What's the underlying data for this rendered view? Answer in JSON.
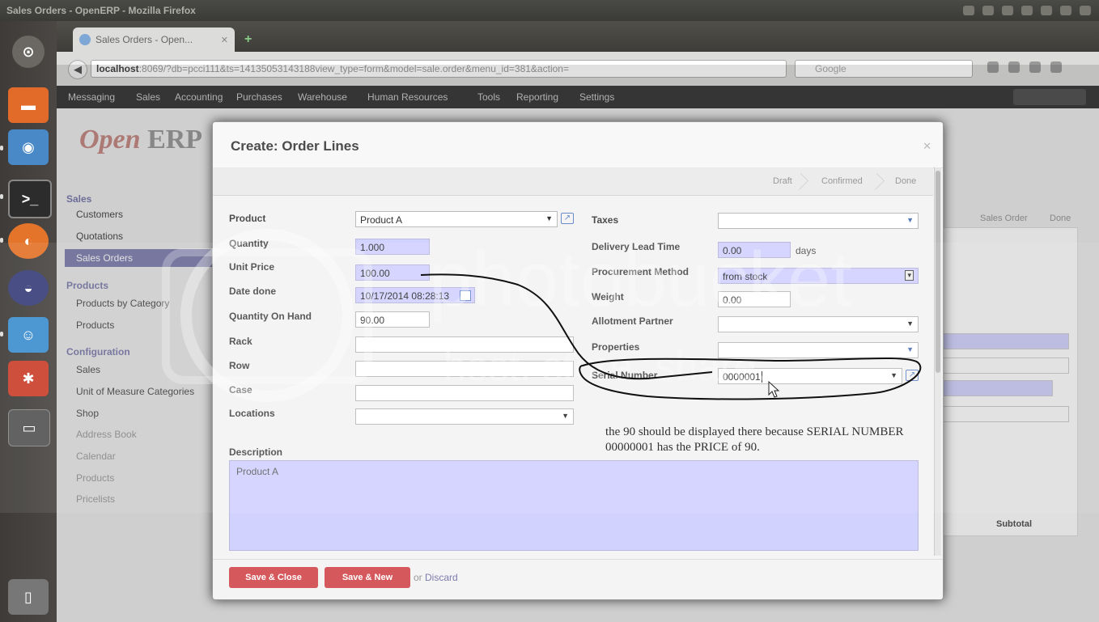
{
  "os": {
    "window_title": "Sales Orders - OpenERP - Mozilla Firefox"
  },
  "browser": {
    "tab_title": "Sales Orders - Open...",
    "url_host": "localhost",
    "url_rest": ":8069/?db=pcci111&ts=14135053143188view_type=form&model=sale.order&menu_id=381&action=",
    "search_placeholder": "Google"
  },
  "erp": {
    "top_menu": [
      "Messaging",
      "Sales",
      "Accounting",
      "Purchases",
      "Warehouse",
      "Human Resources",
      "Tools",
      "Reporting",
      "Settings"
    ],
    "logo_open": "Open",
    "logo_erp": "ERP",
    "sidebar": {
      "sales_header": "Sales",
      "sales_items": [
        "Customers",
        "Quotations",
        "Sales Orders"
      ],
      "products_header": "Products",
      "products_items": [
        "Products by Category",
        "Products"
      ],
      "configuration_header": "Configuration",
      "configuration_items": [
        "Sales",
        "Unit of Measure Categories",
        "Shop",
        "Address Book",
        "Calendar",
        "Products",
        "Pricelists"
      ]
    },
    "background": {
      "stages": [
        "Sales Order",
        "Done"
      ],
      "subtotal_header": "Subtotal"
    }
  },
  "modal": {
    "title": "Create: Order Lines",
    "stages": [
      "Draft",
      "Confirmed",
      "Done"
    ],
    "left": {
      "product_label": "Product",
      "product_value": "Product A",
      "quantity_label": "Quantity",
      "quantity_value": "1.000",
      "unit_price_label": "Unit Price",
      "unit_price_value": "100.00",
      "date_done_label": "Date done",
      "date_done_value": "10/17/2014 08:28:13",
      "qty_on_hand_label": "Quantity On Hand",
      "qty_on_hand_value": "90.00",
      "rack_label": "Rack",
      "row_label": "Row",
      "case_label": "Case",
      "locations_label": "Locations"
    },
    "right": {
      "taxes_label": "Taxes",
      "delivery_lead_time_label": "Delivery Lead Time",
      "delivery_lead_time_value": "0.00",
      "days_label": "days",
      "procurement_label": "Procurement Method",
      "procurement_value": "from stock",
      "weight_label": "Weight",
      "weight_value": "0.00",
      "allotment_label": "Allotment Partner",
      "properties_label": "Properties",
      "serial_label": "Serial Number",
      "serial_value": "0000001"
    },
    "description_label": "Description",
    "description_value": "Product A",
    "annotation": "the 90 should be displayed there because SERIAL NUMBER 00000001 has the PRICE of 90.",
    "buttons": {
      "save_close": "Save & Close",
      "save_new": "Save & New",
      "or": "or",
      "discard": "Discard"
    }
  },
  "watermark": {
    "text1": "photobucket",
    "text2": "host. store. share."
  }
}
